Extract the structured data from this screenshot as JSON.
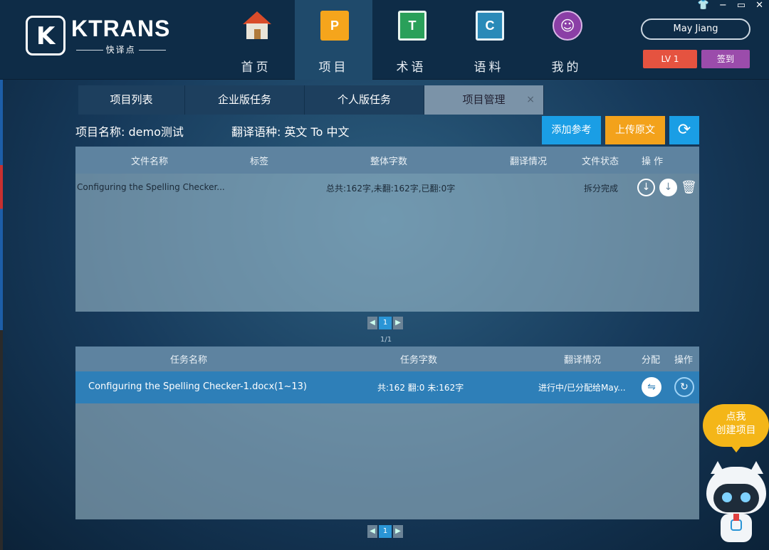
{
  "app": {
    "logo_title": "KTRANS",
    "logo_sub": "快译点"
  },
  "nav": [
    {
      "label": "首页",
      "icon": "home-icon"
    },
    {
      "label": "项目",
      "icon": "project-icon",
      "glyph": "P",
      "active": true
    },
    {
      "label": "术语",
      "icon": "term-icon",
      "glyph": "T"
    },
    {
      "label": "语料",
      "icon": "corpus-icon",
      "glyph": "C"
    },
    {
      "label": "我的",
      "icon": "profile-icon"
    }
  ],
  "window_controls": {
    "skin": "👕",
    "minimize": "−",
    "maximize": "▭",
    "close": "✕"
  },
  "user": {
    "name": "May Jiang",
    "level": "LV 1",
    "signin": "签到"
  },
  "tabs": [
    {
      "label": "项目列表"
    },
    {
      "label": "企业版任务"
    },
    {
      "label": "个人版任务"
    },
    {
      "label": "项目管理",
      "active": true,
      "close": "×"
    }
  ],
  "project": {
    "name": "项目名称: demo测试",
    "language": "翻译语种:  英文 To 中文"
  },
  "buttons": {
    "add_reference": "添加参考",
    "upload_source": "上传原文",
    "refresh": "⟳"
  },
  "files_table": {
    "headers": {
      "name": "文件名称",
      "tag": "标签",
      "words": "整体字数",
      "translation": "翻译情况",
      "status": "文件状态",
      "actions": "操  作"
    },
    "rows": [
      {
        "name": "Configuring the Spelling Checker...",
        "words": "总共:162字,未翻:162字,已翻:0字",
        "status": "拆分完成"
      }
    ],
    "page": "1",
    "page_text": "1/1"
  },
  "tasks_table": {
    "headers": {
      "name": "任务名称",
      "words": "任务字数",
      "translation": "翻译情况",
      "assign": "分配",
      "actions": "操作"
    },
    "rows": [
      {
        "name": "Configuring the Spelling Checker-1.docx(1~13)",
        "words": "共:162 翻:0 未:162字",
        "translation": "进行中/已分配给May..."
      }
    ],
    "page": "1"
  },
  "mascot": {
    "bubble": "点我\n创建项目"
  },
  "colors": {
    "accent": "#1a9ee5",
    "orange": "#f3a21b",
    "level": "#e55340",
    "signin": "#9b4cab"
  }
}
